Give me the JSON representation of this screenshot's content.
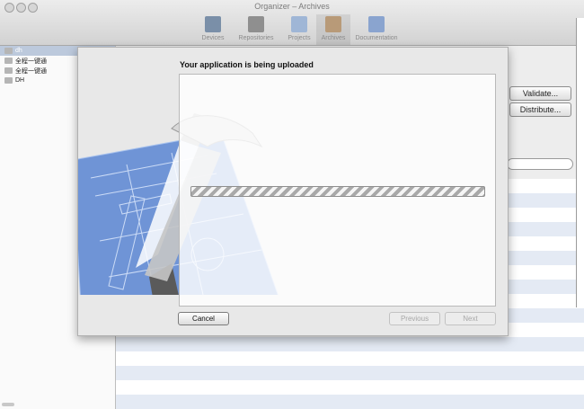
{
  "window": {
    "title": "Organizer – Archives"
  },
  "toolbar": {
    "items": [
      {
        "label": "Devices",
        "icon": "devices-icon",
        "color": "#7a8fa8"
      },
      {
        "label": "Repositories",
        "icon": "repositories-icon",
        "color": "#8f8f8f"
      },
      {
        "label": "Projects",
        "icon": "projects-icon",
        "color": "#9fb6d6"
      },
      {
        "label": "Archives",
        "icon": "archives-icon",
        "color": "#b89a78",
        "active": true
      },
      {
        "label": "Documentation",
        "icon": "documentation-icon",
        "color": "#8aa4cf"
      }
    ]
  },
  "sidebar": {
    "items": [
      {
        "label": "dh",
        "selected": true
      },
      {
        "label": "全程一键通"
      },
      {
        "label": "全程一键通"
      },
      {
        "label": "DH"
      }
    ]
  },
  "main": {
    "validate_label": "Validate...",
    "distribute_label": "Distribute..."
  },
  "sheet": {
    "title": "Your application is being uploaded",
    "progress_state": "indeterminate",
    "cancel_label": "Cancel",
    "previous_label": "Previous",
    "next_label": "Next"
  },
  "colors": {
    "blueprint": "#6f94d6",
    "selection": "#bcc9dc",
    "row_alt": "#e4eaf4"
  }
}
